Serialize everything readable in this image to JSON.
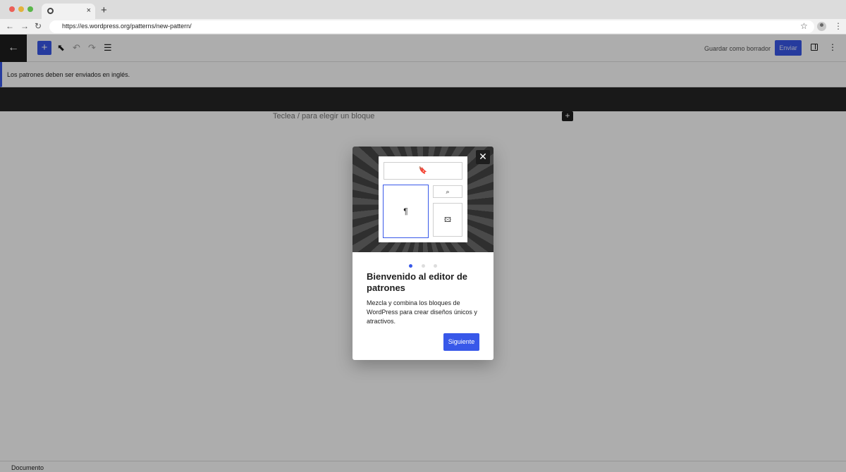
{
  "browser": {
    "tab_close": "×",
    "new_tab": "+",
    "url": "https://es.wordpress.org/patterns/new-pattern/",
    "icons": {
      "back": "←",
      "forward": "→",
      "reload": "↻",
      "bookmark": "☆",
      "menu": "⋮"
    }
  },
  "toolbar": {
    "back_icon": "←",
    "inserter_icon": "+",
    "tools_icon": "⬉",
    "undo_icon": "↶",
    "redo_icon": "↷",
    "list_view_icon": "☰",
    "save_draft_label": "Guardar como borrador",
    "submit_label": "Enviar",
    "more_icon": "⋮"
  },
  "notice": {
    "text": "Los patrones deben ser enviados en inglés."
  },
  "editor": {
    "block_placeholder": "Teclea / para elegir un bloque",
    "block_inserter_icon": "+"
  },
  "statusbar": {
    "label": "Documento"
  },
  "guide": {
    "close_icon": "✕",
    "illustration_icons": {
      "header": "🔖",
      "paragraph": "¶",
      "search": "⌕",
      "image": "🖾"
    },
    "pages_total": 3,
    "page_current": 1,
    "title": "Bienvenido al editor de patrones",
    "body": "Mezcla y combina los bloques de WordPress para crear diseños únicos y atractivos.",
    "next_label": "Siguiente"
  },
  "colors": {
    "accent": "#3858e9",
    "toolbar_dark": "#1e1e1e"
  }
}
